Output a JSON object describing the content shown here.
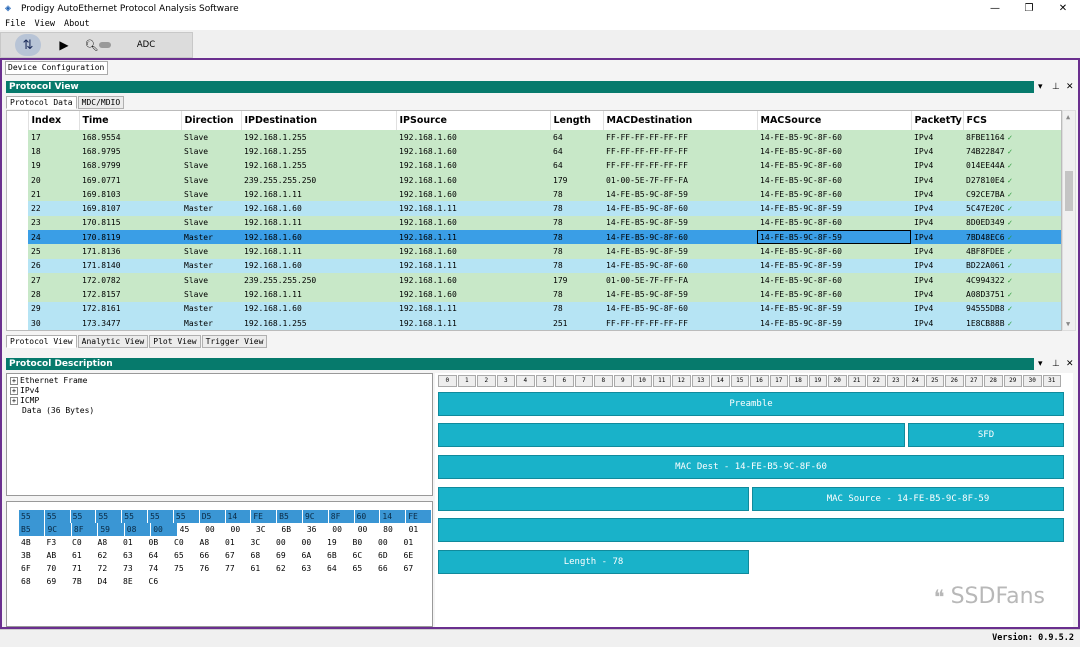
{
  "window": {
    "title": "Prodigy AutoEthernet Protocol Analysis Software",
    "min": "—",
    "max": "❐",
    "close": "✕"
  },
  "menu": [
    "File",
    "View",
    "About"
  ],
  "toolbar": {
    "adc_label": "ADC"
  },
  "device_config_tab": "Device Configuration",
  "protocol_view": {
    "title": "Protocol View",
    "tabs": [
      "Protocol Data",
      "MDC/MDIO"
    ],
    "columns": [
      "Index",
      "Time",
      "Direction",
      "IPDestination",
      "IPSource",
      "Length",
      "MACDestination",
      "MACSource",
      "PacketTy",
      "FCS"
    ],
    "rows": [
      {
        "index": "17",
        "time": "168.9554",
        "dir": "Slave",
        "ipdst": "192.168.1.255",
        "ipsrc": "192.168.1.60",
        "len": "64",
        "macdst": "FF-FF-FF-FF-FF-FF",
        "macsrc": "14-FE-B5-9C-8F-60",
        "type": "IPv4",
        "fcs": "8FBE1164"
      },
      {
        "index": "18",
        "time": "168.9795",
        "dir": "Slave",
        "ipdst": "192.168.1.255",
        "ipsrc": "192.168.1.60",
        "len": "64",
        "macdst": "FF-FF-FF-FF-FF-FF",
        "macsrc": "14-FE-B5-9C-8F-60",
        "type": "IPv4",
        "fcs": "74B22847"
      },
      {
        "index": "19",
        "time": "168.9799",
        "dir": "Slave",
        "ipdst": "192.168.1.255",
        "ipsrc": "192.168.1.60",
        "len": "64",
        "macdst": "FF-FF-FF-FF-FF-FF",
        "macsrc": "14-FE-B5-9C-8F-60",
        "type": "IPv4",
        "fcs": "014EE44A"
      },
      {
        "index": "20",
        "time": "169.0771",
        "dir": "Slave",
        "ipdst": "239.255.255.250",
        "ipsrc": "192.168.1.60",
        "len": "179",
        "macdst": "01-00-5E-7F-FF-FA",
        "macsrc": "14-FE-B5-9C-8F-60",
        "type": "IPv4",
        "fcs": "D27810E4"
      },
      {
        "index": "21",
        "time": "169.8103",
        "dir": "Slave",
        "ipdst": "192.168.1.11",
        "ipsrc": "192.168.1.60",
        "len": "78",
        "macdst": "14-FE-B5-9C-8F-59",
        "macsrc": "14-FE-B5-9C-8F-60",
        "type": "IPv4",
        "fcs": "C92CE7BA"
      },
      {
        "index": "22",
        "time": "169.8107",
        "dir": "Master",
        "ipdst": "192.168.1.60",
        "ipsrc": "192.168.1.11",
        "len": "78",
        "macdst": "14-FE-B5-9C-8F-60",
        "macsrc": "14-FE-B5-9C-8F-59",
        "type": "IPv4",
        "fcs": "5C47E20C"
      },
      {
        "index": "23",
        "time": "170.8115",
        "dir": "Slave",
        "ipdst": "192.168.1.11",
        "ipsrc": "192.168.1.60",
        "len": "78",
        "macdst": "14-FE-B5-9C-8F-59",
        "macsrc": "14-FE-B5-9C-8F-60",
        "type": "IPv4",
        "fcs": "8D0ED349"
      },
      {
        "index": "24",
        "time": "170.8119",
        "dir": "Master",
        "ipdst": "192.168.1.60",
        "ipsrc": "192.168.1.11",
        "len": "78",
        "macdst": "14-FE-B5-9C-8F-60",
        "macsrc": "14-FE-B5-9C-8F-59",
        "type": "IPv4",
        "fcs": "7BD48EC6"
      },
      {
        "index": "25",
        "time": "171.8136",
        "dir": "Slave",
        "ipdst": "192.168.1.11",
        "ipsrc": "192.168.1.60",
        "len": "78",
        "macdst": "14-FE-B5-9C-8F-59",
        "macsrc": "14-FE-B5-9C-8F-60",
        "type": "IPv4",
        "fcs": "4BF8FDEE"
      },
      {
        "index": "26",
        "time": "171.8140",
        "dir": "Master",
        "ipdst": "192.168.1.60",
        "ipsrc": "192.168.1.11",
        "len": "78",
        "macdst": "14-FE-B5-9C-8F-60",
        "macsrc": "14-FE-B5-9C-8F-59",
        "type": "IPv4",
        "fcs": "BD22A061"
      },
      {
        "index": "27",
        "time": "172.0782",
        "dir": "Slave",
        "ipdst": "239.255.255.250",
        "ipsrc": "192.168.1.60",
        "len": "179",
        "macdst": "01-00-5E-7F-FF-FA",
        "macsrc": "14-FE-B5-9C-8F-60",
        "type": "IPv4",
        "fcs": "4C994322"
      },
      {
        "index": "28",
        "time": "172.8157",
        "dir": "Slave",
        "ipdst": "192.168.1.11",
        "ipsrc": "192.168.1.60",
        "len": "78",
        "macdst": "14-FE-B5-9C-8F-59",
        "macsrc": "14-FE-B5-9C-8F-60",
        "type": "IPv4",
        "fcs": "A08D3751"
      },
      {
        "index": "29",
        "time": "172.8161",
        "dir": "Master",
        "ipdst": "192.168.1.60",
        "ipsrc": "192.168.1.11",
        "len": "78",
        "macdst": "14-FE-B5-9C-8F-60",
        "macsrc": "14-FE-B5-9C-8F-59",
        "type": "IPv4",
        "fcs": "94555DB8"
      },
      {
        "index": "30",
        "time": "173.3477",
        "dir": "Master",
        "ipdst": "192.168.1.255",
        "ipsrc": "192.168.1.11",
        "len": "251",
        "macdst": "FF-FF-FF-FF-FF-FF",
        "macsrc": "14-FE-B5-9C-8F-59",
        "type": "IPv4",
        "fcs": "1E8CB88B"
      }
    ],
    "bottom_tabs": [
      "Protocol View",
      "Analytic View",
      "Plot View",
      "Trigger View"
    ]
  },
  "protocol_description": {
    "title": "Protocol Description",
    "tree": [
      {
        "label": "Ethernet Frame",
        "expand": true
      },
      {
        "label": "IPv4",
        "expand": true
      },
      {
        "label": "ICMP",
        "expand": true
      },
      {
        "label": "Data (36 Bytes)",
        "expand": false
      }
    ],
    "hex": [
      [
        "55",
        "55",
        "55",
        "55",
        "55",
        "55",
        "55",
        "D5",
        "14",
        "FE",
        "B5",
        "9C",
        "8F",
        "60",
        "14",
        "FE"
      ],
      [
        "B5",
        "9C",
        "8F",
        "59",
        "08",
        "00",
        "45",
        "00",
        "00",
        "3C",
        "6B",
        "36",
        "00",
        "00",
        "80",
        "01"
      ],
      [
        "4B",
        "F3",
        "C0",
        "A8",
        "01",
        "0B",
        "C0",
        "A8",
        "01",
        "3C",
        "00",
        "00",
        "19",
        "B0",
        "00",
        "01"
      ],
      [
        "3B",
        "AB",
        "61",
        "62",
        "63",
        "64",
        "65",
        "66",
        "67",
        "68",
        "69",
        "6A",
        "6B",
        "6C",
        "6D",
        "6E"
      ],
      [
        "6F",
        "70",
        "71",
        "72",
        "73",
        "74",
        "75",
        "76",
        "77",
        "61",
        "62",
        "63",
        "64",
        "65",
        "66",
        "67"
      ],
      [
        "68",
        "69",
        "7B",
        "D4",
        "8E",
        "C6"
      ]
    ],
    "bits": [
      "0",
      "1",
      "2",
      "3",
      "4",
      "5",
      "6",
      "7",
      "8",
      "9",
      "10",
      "11",
      "12",
      "13",
      "14",
      "15",
      "16",
      "17",
      "18",
      "19",
      "20",
      "21",
      "22",
      "23",
      "24",
      "25",
      "26",
      "27",
      "28",
      "29",
      "30",
      "31"
    ],
    "fields": {
      "preamble": "Preamble",
      "sfd": "SFD",
      "macdest": "MAC Dest - 14-FE-B5-9C-8F-60",
      "macsrc": "MAC Source - 14-FE-B5-9C-8F-59",
      "length": "Length - 78"
    }
  },
  "status": {
    "version": "Version: 0.9.5.2"
  },
  "watermark": "SSDFans",
  "colors": {
    "panel_header": "#067a6c",
    "slave_row": "#c8e8c8",
    "master_row": "#b6e4f4",
    "selected_row": "#3a9ee6",
    "field": "#19b2c9",
    "frame_border": "#6a2f8e"
  }
}
